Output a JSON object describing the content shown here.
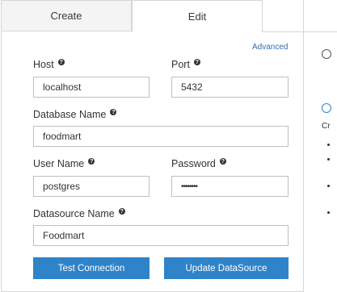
{
  "tabs": {
    "create": "Create",
    "edit": "Edit"
  },
  "advanced_link": "Advanced",
  "fields": {
    "host": {
      "label": "Host",
      "value": "localhost"
    },
    "port": {
      "label": "Port",
      "value": "5432"
    },
    "database_name": {
      "label": "Database Name",
      "value": "foodmart"
    },
    "user_name": {
      "label": "User Name",
      "value": "postgres"
    },
    "password": {
      "label": "Password",
      "value": "••••••••"
    },
    "datasource_name": {
      "label": "Datasource Name",
      "value": "Foodmart"
    }
  },
  "help_glyph": "?",
  "buttons": {
    "test": "Test Connection",
    "update": "Update DataSource"
  },
  "side": {
    "cr_text": "Cr",
    "icon_glyph": "⊘"
  },
  "colors": {
    "accent": "#2f83c8",
    "link": "#2f6fb0",
    "border": "#d7d7d7"
  }
}
